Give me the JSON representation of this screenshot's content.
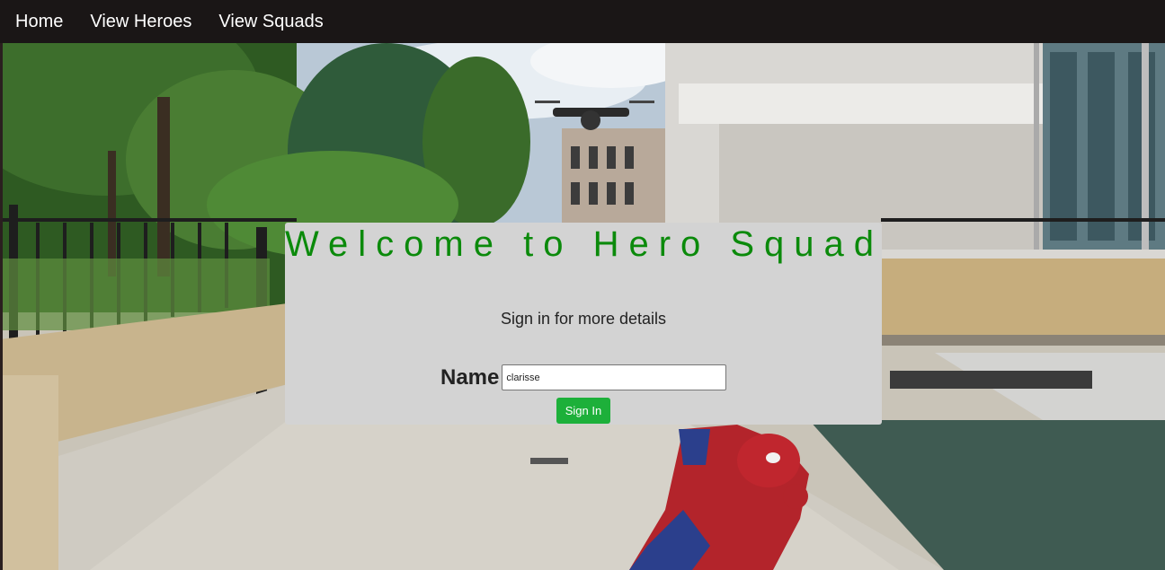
{
  "nav": {
    "items": [
      {
        "label": "Home"
      },
      {
        "label": "View Heroes"
      },
      {
        "label": "View Squads"
      }
    ]
  },
  "card": {
    "title": "Welcome to Hero Squad",
    "subtitle": "Sign in for more details",
    "name_label": "Name",
    "name_value": "clarisse",
    "button_label": "Sign In"
  },
  "colors": {
    "navbar_bg": "#1a1616",
    "title_green": "#0b8a0b",
    "card_bg": "#d3d3d3",
    "button_green": "#1db03a"
  }
}
